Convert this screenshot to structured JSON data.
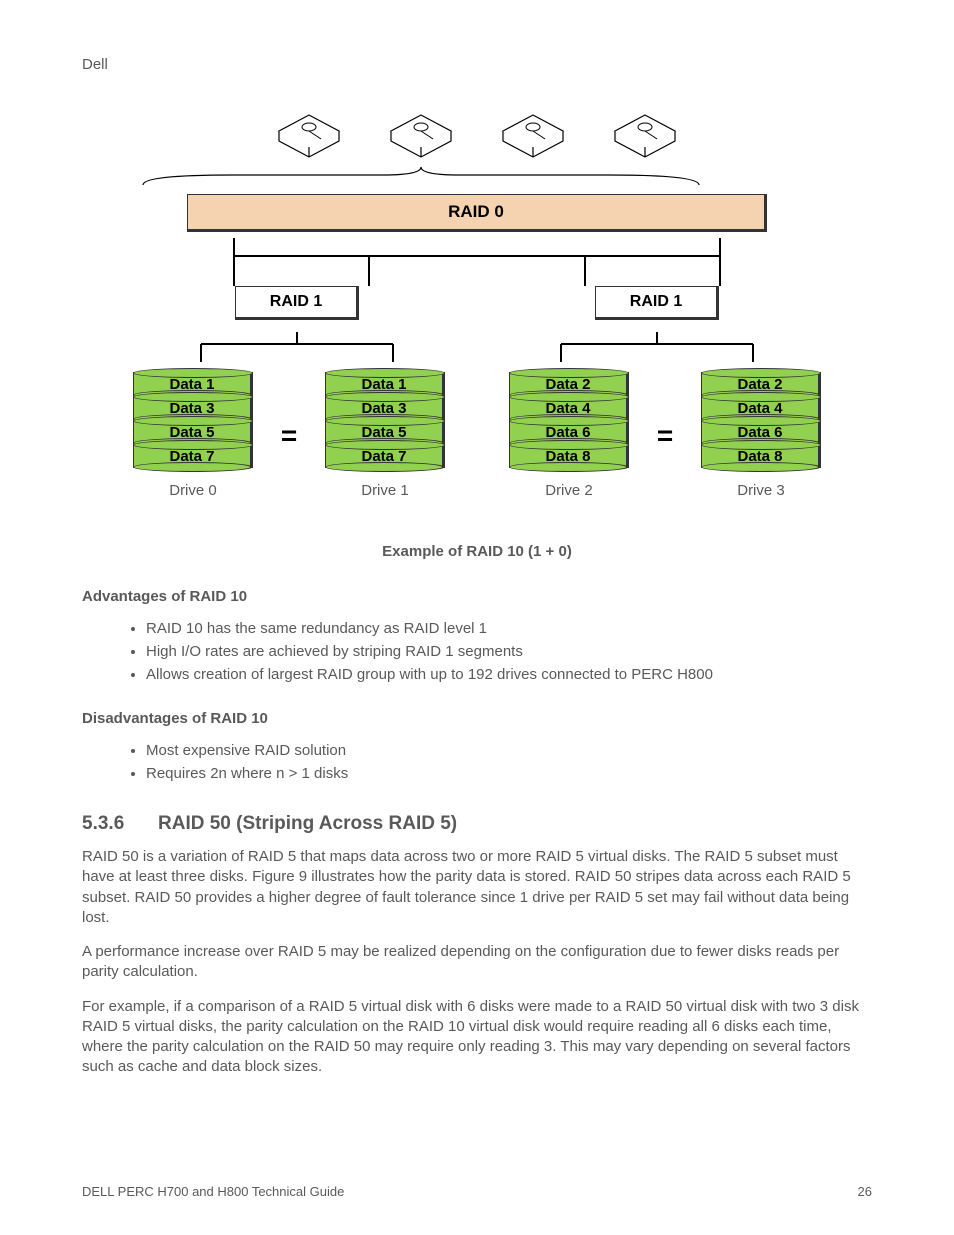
{
  "header": "Dell",
  "diagram": {
    "raid0": "RAID 0",
    "raid1": "RAID 1",
    "drives": [
      {
        "label": "Drive 0",
        "data": [
          "Data 1",
          "Data 3",
          "Data 5",
          "Data 7"
        ]
      },
      {
        "label": "Drive 1",
        "data": [
          "Data 1",
          "Data 3",
          "Data 5",
          "Data 7"
        ]
      },
      {
        "label": "Drive 2",
        "data": [
          "Data 2",
          "Data 4",
          "Data 6",
          "Data 8"
        ]
      },
      {
        "label": "Drive 3",
        "data": [
          "Data 2",
          "Data 4",
          "Data 6",
          "Data 8"
        ]
      }
    ]
  },
  "caption": "Example of RAID 10 (1 + 0)",
  "adv": {
    "title": "Advantages of RAID 10",
    "items": [
      "RAID 10 has the same redundancy as RAID level 1",
      "High I/O rates are achieved by striping RAID 1 segments",
      "Allows creation of largest RAID group with up to 192 drives connected to PERC H800"
    ]
  },
  "dis": {
    "title": "Disadvantages of RAID 10",
    "items": [
      "Most expensive RAID solution",
      "Requires 2n where n > 1 disks"
    ]
  },
  "section": {
    "num": "5.3.6",
    "title": "RAID 50 (Striping Across RAID 5)"
  },
  "para": [
    "RAID 50 is a variation of RAID 5 that maps data across two or more RAID 5 virtual disks. The RAID 5 subset must have at least three disks. Figure 9 illustrates how the parity data is stored. RAID 50 stripes data across each RAID 5 subset. RAID 50 provides a higher degree of fault tolerance since 1 drive per RAID 5 set may fail without data being lost.",
    "A performance increase over RAID 5 may be realized depending on the configuration due to fewer disks reads per parity calculation.",
    "For example, if a comparison of a RAID 5 virtual disk with 6 disks were made to a RAID 50 virtual disk with two 3 disk RAID 5 virtual disks, the parity calculation on the RAID 10 virtual disk would require reading all 6 disks each time, where the parity calculation on the RAID 50 may require only reading 3. This may vary depending on several factors such as cache and data block sizes."
  ],
  "footer": {
    "left": "DELL PERC H700 and H800 Technical Guide",
    "right": "26"
  }
}
